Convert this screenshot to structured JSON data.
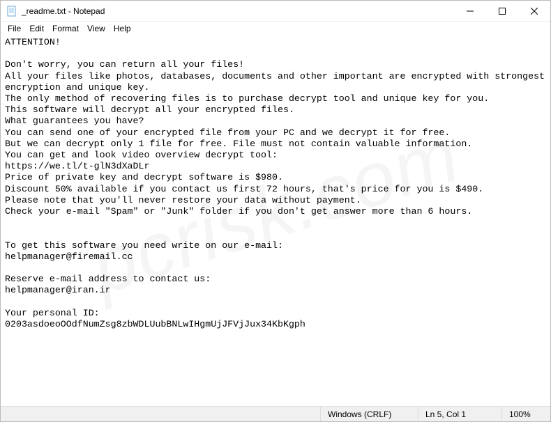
{
  "window": {
    "title": "_readme.txt - Notepad"
  },
  "menu": {
    "file": "File",
    "edit": "Edit",
    "format": "Format",
    "view": "View",
    "help": "Help"
  },
  "content": {
    "text": "ATTENTION!\n\nDon't worry, you can return all your files!\nAll your files like photos, databases, documents and other important are encrypted with strongest encryption and unique key.\nThe only method of recovering files is to purchase decrypt tool and unique key for you.\nThis software will decrypt all your encrypted files.\nWhat guarantees you have?\nYou can send one of your encrypted file from your PC and we decrypt it for free.\nBut we can decrypt only 1 file for free. File must not contain valuable information.\nYou can get and look video overview decrypt tool:\nhttps://we.tl/t-glN3dXaDLr\nPrice of private key and decrypt software is $980.\nDiscount 50% available if you contact us first 72 hours, that's price for you is $490.\nPlease note that you'll never restore your data without payment.\nCheck your e-mail \"Spam\" or \"Junk\" folder if you don't get answer more than 6 hours.\n\n\nTo get this software you need write on our e-mail:\nhelpmanager@firemail.cc\n\nReserve e-mail address to contact us:\nhelpmanager@iran.ir\n\nYour personal ID:\n0203asdoeoOOdfNumZsg8zbWDLUubBNLwIHgmUjJFVjJux34KbKgph"
  },
  "statusbar": {
    "encoding": "Windows (CRLF)",
    "position": "Ln 5, Col 1",
    "zoom": "100%"
  },
  "watermark": "pcrisk.com"
}
